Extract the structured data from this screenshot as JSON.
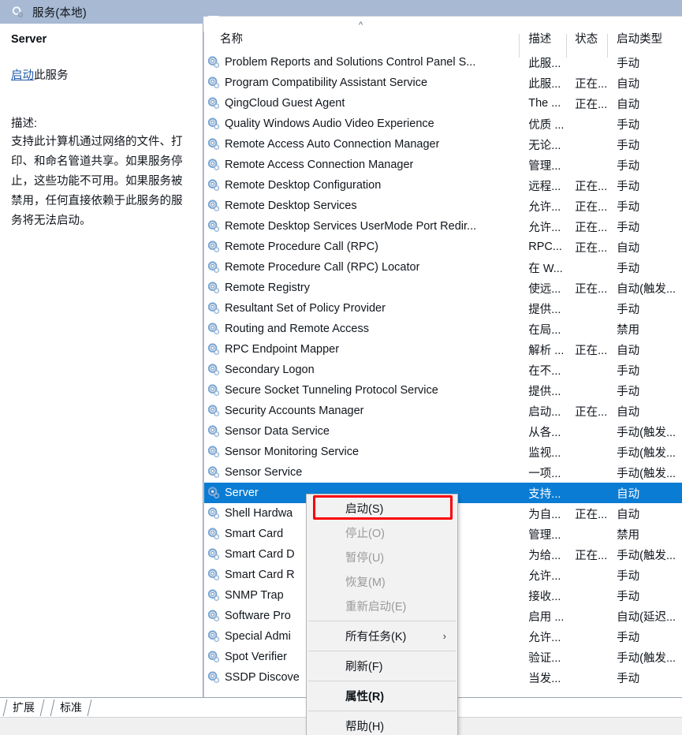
{
  "window": {
    "header_title": "服务(本地)",
    "header_icon": "service-gear-icon"
  },
  "details_pane": {
    "service_name": "Server",
    "action_link": "启动",
    "action_suffix": "此服务",
    "description_label": "描述:",
    "description_text": "支持此计算机通过网络的文件、打印、和命名管道共享。如果服务停止，这些功能不可用。如果服务被禁用，任何直接依赖于此服务的服务将无法启动。"
  },
  "list": {
    "sort_indicator": "^",
    "columns": [
      {
        "key": "name",
        "label": "名称"
      },
      {
        "key": "desc",
        "label": "描述"
      },
      {
        "key": "state",
        "label": "状态"
      },
      {
        "key": "startup",
        "label": "启动类型"
      }
    ],
    "rows": [
      {
        "name": "Problem Reports and Solutions Control Panel S...",
        "desc": "此服...",
        "state": "",
        "startup": "手动",
        "selected": false
      },
      {
        "name": "Program Compatibility Assistant Service",
        "desc": "此服...",
        "state": "正在...",
        "startup": "自动",
        "selected": false
      },
      {
        "name": "QingCloud Guest Agent",
        "desc": "The ...",
        "state": "正在...",
        "startup": "自动",
        "selected": false
      },
      {
        "name": "Quality Windows Audio Video Experience",
        "desc": "优质 ...",
        "state": "",
        "startup": "手动",
        "selected": false
      },
      {
        "name": "Remote Access Auto Connection Manager",
        "desc": "无论...",
        "state": "",
        "startup": "手动",
        "selected": false
      },
      {
        "name": "Remote Access Connection Manager",
        "desc": "管理...",
        "state": "",
        "startup": "手动",
        "selected": false
      },
      {
        "name": "Remote Desktop Configuration",
        "desc": "远程...",
        "state": "正在...",
        "startup": "手动",
        "selected": false
      },
      {
        "name": "Remote Desktop Services",
        "desc": "允许...",
        "state": "正在...",
        "startup": "手动",
        "selected": false
      },
      {
        "name": "Remote Desktop Services UserMode Port Redir...",
        "desc": "允许...",
        "state": "正在...",
        "startup": "手动",
        "selected": false
      },
      {
        "name": "Remote Procedure Call (RPC)",
        "desc": "RPC...",
        "state": "正在...",
        "startup": "自动",
        "selected": false
      },
      {
        "name": "Remote Procedure Call (RPC) Locator",
        "desc": "在 W...",
        "state": "",
        "startup": "手动",
        "selected": false
      },
      {
        "name": "Remote Registry",
        "desc": "使远...",
        "state": "正在...",
        "startup": "自动(触发...",
        "selected": false
      },
      {
        "name": "Resultant Set of Policy Provider",
        "desc": "提供...",
        "state": "",
        "startup": "手动",
        "selected": false
      },
      {
        "name": "Routing and Remote Access",
        "desc": "在局...",
        "state": "",
        "startup": "禁用",
        "selected": false
      },
      {
        "name": "RPC Endpoint Mapper",
        "desc": "解析 ...",
        "state": "正在...",
        "startup": "自动",
        "selected": false
      },
      {
        "name": "Secondary Logon",
        "desc": "在不...",
        "state": "",
        "startup": "手动",
        "selected": false
      },
      {
        "name": "Secure Socket Tunneling Protocol Service",
        "desc": "提供...",
        "state": "",
        "startup": "手动",
        "selected": false
      },
      {
        "name": "Security Accounts Manager",
        "desc": "启动...",
        "state": "正在...",
        "startup": "自动",
        "selected": false
      },
      {
        "name": "Sensor Data Service",
        "desc": "从各...",
        "state": "",
        "startup": "手动(触发...",
        "selected": false
      },
      {
        "name": "Sensor Monitoring Service",
        "desc": "监视...",
        "state": "",
        "startup": "手动(触发...",
        "selected": false
      },
      {
        "name": "Sensor Service",
        "desc": "一项...",
        "state": "",
        "startup": "手动(触发...",
        "selected": false
      },
      {
        "name": "Server",
        "desc": "支持...",
        "state": "",
        "startup": "自动",
        "selected": true
      },
      {
        "name": "Shell Hardwa",
        "desc": "为自...",
        "state": "正在...",
        "startup": "自动",
        "selected": false
      },
      {
        "name": "Smart Card",
        "desc": "管理...",
        "state": "",
        "startup": "禁用",
        "selected": false
      },
      {
        "name": "Smart Card D",
        "desc": "为给...",
        "state": "正在...",
        "startup": "手动(触发...",
        "selected": false
      },
      {
        "name": "Smart Card R",
        "desc": "允许...",
        "state": "",
        "startup": "手动",
        "selected": false
      },
      {
        "name": "SNMP Trap",
        "desc": "接收...",
        "state": "",
        "startup": "手动",
        "selected": false
      },
      {
        "name": "Software Pro",
        "desc": "启用 ...",
        "state": "",
        "startup": "自动(延迟...",
        "selected": false
      },
      {
        "name": "Special Admi",
        "desc": "允许...",
        "state": "",
        "startup": "手动",
        "selected": false
      },
      {
        "name": "Spot Verifier",
        "desc": "验证...",
        "state": "",
        "startup": "手动(触发...",
        "selected": false
      },
      {
        "name": "SSDP Discove",
        "desc": "当发...",
        "state": "",
        "startup": "手动",
        "selected": false
      }
    ]
  },
  "context_menu": {
    "items": [
      {
        "label": "启动(S)",
        "disabled": false,
        "bold": false,
        "submenu": false,
        "highlighted": true
      },
      {
        "label": "停止(O)",
        "disabled": true,
        "bold": false,
        "submenu": false,
        "highlighted": false
      },
      {
        "label": "暂停(U)",
        "disabled": true,
        "bold": false,
        "submenu": false,
        "highlighted": false
      },
      {
        "label": "恢复(M)",
        "disabled": true,
        "bold": false,
        "submenu": false,
        "highlighted": false
      },
      {
        "label": "重新启动(E)",
        "disabled": true,
        "bold": false,
        "submenu": false,
        "highlighted": false
      },
      {
        "sep": true
      },
      {
        "label": "所有任务(K)",
        "disabled": false,
        "bold": false,
        "submenu": true,
        "highlighted": false,
        "arrow": "›"
      },
      {
        "sep": true
      },
      {
        "label": "刷新(F)",
        "disabled": false,
        "bold": false,
        "submenu": false,
        "highlighted": false
      },
      {
        "sep": true
      },
      {
        "label": "属性(R)",
        "disabled": false,
        "bold": true,
        "submenu": false,
        "highlighted": false
      },
      {
        "sep": true
      },
      {
        "label": "帮助(H)",
        "disabled": false,
        "bold": false,
        "submenu": false,
        "highlighted": false
      }
    ]
  },
  "tabs": [
    {
      "label": "扩展",
      "active": false
    },
    {
      "label": "标准",
      "active": true
    }
  ],
  "colors": {
    "selection_blue": "#0a7cd4",
    "header_blue": "#a7b9d3",
    "link_blue": "#2159a8",
    "annotation_red": "#fb0007"
  }
}
